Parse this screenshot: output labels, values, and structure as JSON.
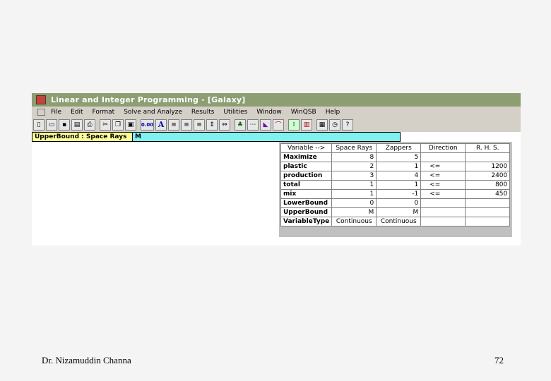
{
  "window": {
    "title": "Linear and Integer Programming - [Galaxy]"
  },
  "menu": [
    "File",
    "Edit",
    "Format",
    "Solve and Analyze",
    "Results",
    "Utilities",
    "Window",
    "WinQSB",
    "Help"
  ],
  "toolbar": {
    "number_format_label": "0.00",
    "font_label": "A"
  },
  "formula_bar": {
    "cell_reference": "UpperBound : Space Rays",
    "cell_value": "M"
  },
  "grid": {
    "headers": [
      "Variable -->",
      "Space Rays",
      "Zappers",
      "Direction",
      "R. H. S."
    ],
    "rows": [
      {
        "label": "Maximize",
        "space_rays": "8",
        "zappers": "5",
        "direction": "",
        "rhs": ""
      },
      {
        "label": "plastic",
        "space_rays": "2",
        "zappers": "1",
        "direction": "<=",
        "rhs": "1200"
      },
      {
        "label": "production",
        "space_rays": "3",
        "zappers": "4",
        "direction": "<=",
        "rhs": "2400"
      },
      {
        "label": "total",
        "space_rays": "1",
        "zappers": "1",
        "direction": "<=",
        "rhs": "800"
      },
      {
        "label": "mix",
        "space_rays": "1",
        "zappers": "-1",
        "direction": "<=",
        "rhs": "450"
      },
      {
        "label": "LowerBound",
        "space_rays": "0",
        "zappers": "0",
        "direction": "",
        "rhs": ""
      },
      {
        "label": "UpperBound",
        "space_rays": "M",
        "zappers": "M",
        "direction": "",
        "rhs": ""
      },
      {
        "label": "VariableType",
        "space_rays": "Continuous",
        "zappers": "Continuous",
        "direction": "",
        "rhs": ""
      }
    ]
  },
  "slide": {
    "author": "Dr. Nizamuddin Channa",
    "page_number": "72"
  }
}
